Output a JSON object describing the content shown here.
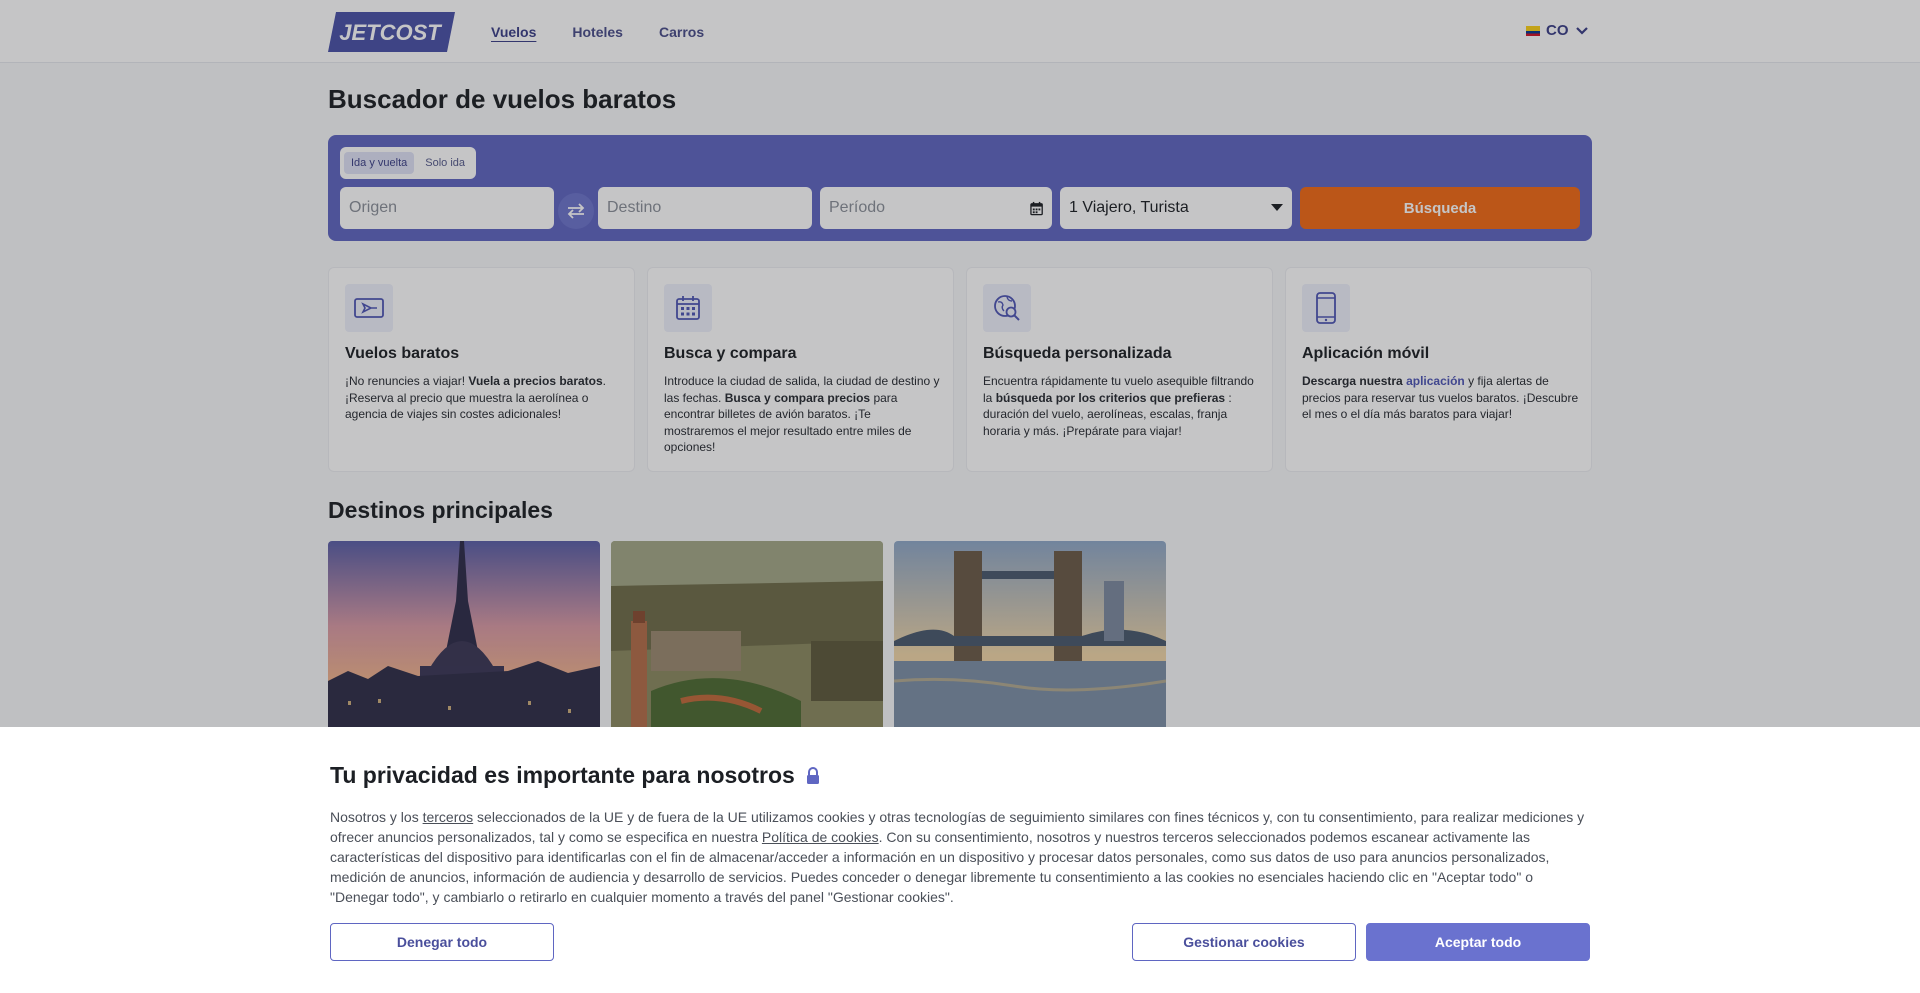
{
  "header": {
    "logo_text": "JETCOST",
    "nav": [
      "Vuelos",
      "Hoteles",
      "Carros"
    ],
    "country": "CO"
  },
  "page_title": "Buscador de vuelos baratos",
  "search": {
    "trip_types": [
      "Ida y vuelta",
      "Solo ida"
    ],
    "origin_placeholder": "Origen",
    "destination_placeholder": "Destino",
    "period_placeholder": "Período",
    "passengers": "1 Viajero, Turista",
    "button": "Búsqueda"
  },
  "features": [
    {
      "title": "Vuelos baratos",
      "icon": "plane-ticket-icon",
      "text_a": "¡No renuncies a viajar! ",
      "bold_a": "Vuela a precios baratos",
      "text_b": ". ¡Reserva al precio que muestra la aerolínea o agencia de viajes sin costes adicionales!"
    },
    {
      "title": "Busca y compara",
      "icon": "calendar-icon",
      "text_a": "Introduce la ciudad de salida, la ciudad de destino y las fechas. ",
      "bold_a": "Busca y compara precios",
      "text_b": " para encontrar billetes de avión baratos. ¡Te mostraremos el mejor resultado entre miles de opciones!"
    },
    {
      "title": "Búsqueda personalizada",
      "icon": "globe-search-icon",
      "text_a": "Encuentra rápidamente tu vuelo asequible filtrando la ",
      "bold_a": "búsqueda por los criterios que prefieras",
      "text_b": " : duración del vuelo, aerolíneas, escalas, franja horaria y más. ¡Prepárate para viajar!"
    },
    {
      "title": "Aplicación móvil",
      "icon": "smartphone-icon",
      "bold_a": "Descarga nuestra ",
      "link": "aplicación",
      "text_b": " y fija alertas de precios para reservar tus vuelos baratos. ¡Descubre el mes o el día más baratos para viajar!"
    }
  ],
  "destinations_title": "Destinos principales",
  "cookie": {
    "title": "Tu privacidad es importante para nosotros",
    "p1": "Nosotros y los ",
    "link1": "terceros",
    "p2": " seleccionados de la UE y de fuera de la UE utilizamos cookies y otras tecnologías de seguimiento similares con fines técnicos y, con tu consentimiento, para realizar mediciones y ofrecer anuncios personalizados, tal y como se especifica en nuestra ",
    "link2": "Política de cookies",
    "p3": ". Con su consentimiento, nosotros y nuestros terceros seleccionados podemos escanear activamente las características del dispositivo para identificarlas con el fin de almacenar/acceder a información en un dispositivo y procesar datos personales, como sus datos de uso para anuncios personalizados, medición de anuncios, información de audiencia y desarrollo de servicios. Puedes conceder o denegar libremente tu consentimiento a las cookies no esenciales haciendo clic en \"Aceptar todo\" o \"Denegar todo\", y cambiarlo o retirarlo en cualquier momento a través del panel \"Gestionar cookies\".",
    "deny": "Denegar todo",
    "manage": "Gestionar cookies",
    "accept": "Aceptar todo"
  },
  "colors": {
    "brand": "#5f66c2",
    "search_button": "#f26a15",
    "accept_button": "#6a72cf"
  }
}
